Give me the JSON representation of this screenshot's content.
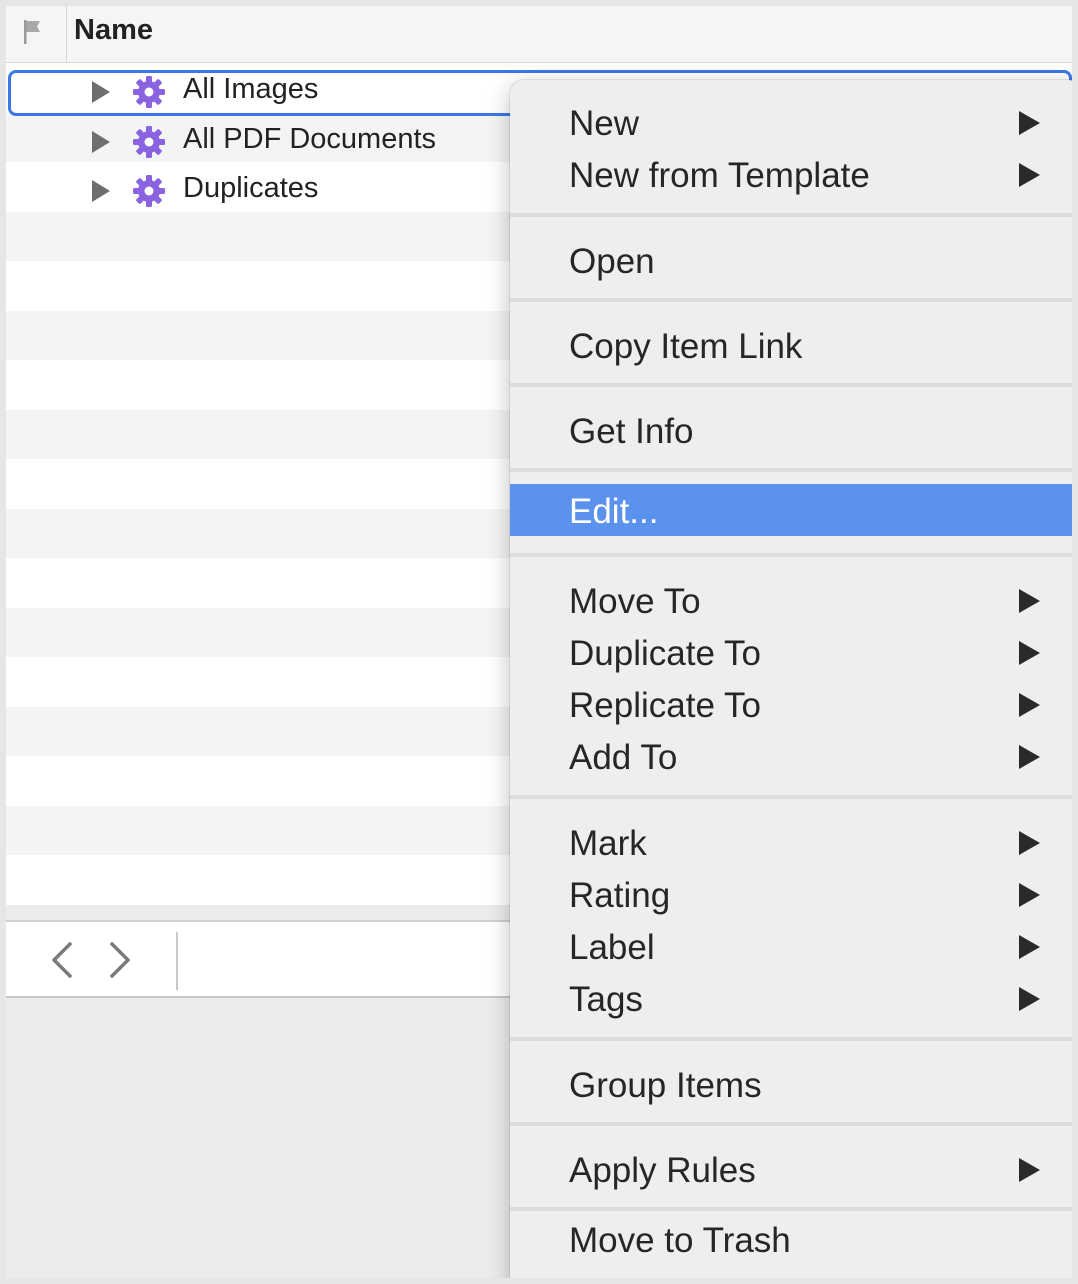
{
  "header": {
    "name_column": "Name",
    "flag_icon": "flag-icon"
  },
  "rows": [
    {
      "label": "All Images",
      "icon": "gear-icon",
      "selected": true
    },
    {
      "label": "All PDF Documents",
      "icon": "gear-icon",
      "selected": false
    },
    {
      "label": "Duplicates",
      "icon": "gear-icon",
      "selected": false
    }
  ],
  "bottombar": {
    "back_icon": "chevron-left-icon",
    "forward_icon": "chevron-right-icon"
  },
  "menu": {
    "items": [
      {
        "label": "New",
        "submenu": true
      },
      {
        "label": "New from Template",
        "submenu": true
      },
      {
        "label": "Open",
        "submenu": false
      },
      {
        "label": "Copy Item Link",
        "submenu": false
      },
      {
        "label": "Get Info",
        "submenu": false
      },
      {
        "label": "Edit...",
        "submenu": false,
        "highlighted": true
      },
      {
        "label": "Move To",
        "submenu": true
      },
      {
        "label": "Duplicate To",
        "submenu": true
      },
      {
        "label": "Replicate To",
        "submenu": true
      },
      {
        "label": "Add To",
        "submenu": true
      },
      {
        "label": "Mark",
        "submenu": true
      },
      {
        "label": "Rating",
        "submenu": true
      },
      {
        "label": "Label",
        "submenu": true
      },
      {
        "label": "Tags",
        "submenu": true
      },
      {
        "label": "Group Items",
        "submenu": false
      },
      {
        "label": "Apply Rules",
        "submenu": true
      },
      {
        "label": "Move to Trash",
        "submenu": false
      }
    ]
  },
  "colors": {
    "selection_ring": "#3b78e7",
    "menu_highlight": "#5b92ee",
    "gear_icon": "#8a63e0"
  }
}
